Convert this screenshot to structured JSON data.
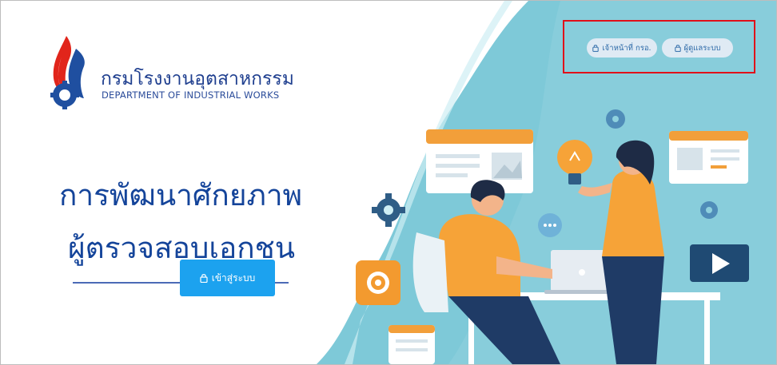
{
  "brand": {
    "name_th": "กรมโรงงานอุตสาหกรรม",
    "name_en": "DEPARTMENT OF INDUSTRIAL WORKS"
  },
  "hero": {
    "line1": "การพัฒนาศักยภาพ",
    "line2": "ผู้ตรวจสอบเอกชน"
  },
  "actions": {
    "login_label": "เข้าสู่ระบบ",
    "staff_login_label": "เจ้าหน้าที่ กรอ.",
    "admin_label": "ผู้ดูแลระบบ"
  },
  "icons": {
    "login": "lock-icon",
    "staff": "lock-icon",
    "admin": "lock-icon"
  },
  "colors": {
    "primary_button": "#1ca2ef",
    "hero_text": "#14449a",
    "highlight_box": "#e0101a",
    "illustration_bg": "#7ec9d8"
  }
}
